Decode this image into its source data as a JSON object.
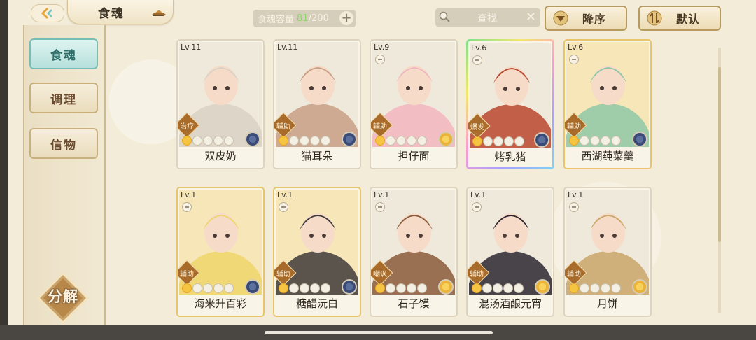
{
  "header": {
    "title": "食魂",
    "capacity_label": "食魂容量",
    "capacity_current": "81",
    "capacity_max": "/200",
    "capacity_add": "+",
    "search_placeholder": "查找",
    "search_clear": "✕",
    "sort_order_label": "降序",
    "sort_mode_label": "默认"
  },
  "sidebar": {
    "tabs": [
      {
        "label": "食魂",
        "active": true
      },
      {
        "label": "调理",
        "active": false
      },
      {
        "label": "信物",
        "active": false
      }
    ],
    "decompose_label": "分解"
  },
  "cards": [
    {
      "level": "Lv.11",
      "role": "治疗",
      "stars": 1,
      "emblem": "blue",
      "name": "双皮奶",
      "frame": "plain",
      "accent": "#d9d2c4"
    },
    {
      "level": "Lv.11",
      "role": "辅助",
      "stars": 1,
      "emblem": "blue",
      "name": "猫耳朵",
      "frame": "plain",
      "accent": "#c79f84"
    },
    {
      "level": "Lv.9",
      "role": "辅助",
      "stars": 1,
      "emblem": "yellow",
      "name": "担仔面",
      "frame": "plain",
      "accent": "#f2b6bf"
    },
    {
      "level": "Lv.6",
      "role": "爆发",
      "stars": 1,
      "emblem": "blue",
      "name": "烤乳猪",
      "frame": "rainbow",
      "accent": "#b8462e"
    },
    {
      "level": "Lv.6",
      "role": "辅助",
      "stars": 1,
      "emblem": "blue",
      "name": "西湖莼菜羹",
      "frame": "gold",
      "accent": "#8fc7a6"
    },
    {
      "level": "Lv.1",
      "role": "辅助",
      "stars": 1,
      "emblem": "blue",
      "name": "海米升百彩",
      "frame": "gold",
      "accent": "#f0d56b"
    },
    {
      "level": "Lv.1",
      "role": "辅助",
      "stars": 1,
      "emblem": "blue",
      "name": "糖醋沅白",
      "frame": "gold",
      "accent": "#3e3a3a"
    },
    {
      "level": "Lv.1",
      "role": "嘲讽",
      "stars": 1,
      "emblem": "yellow",
      "name": "石子馍",
      "frame": "plain",
      "accent": "#8a5a3a"
    },
    {
      "level": "Lv.1",
      "role": "辅助",
      "stars": 1,
      "emblem": "yellow",
      "name": "混汤酒酿元宵",
      "frame": "plain",
      "accent": "#2b2630"
    },
    {
      "level": "Lv.1",
      "role": "辅助",
      "stars": 1,
      "emblem": "yellow",
      "name": "月饼",
      "frame": "plain",
      "accent": "#c9a66a"
    }
  ]
}
